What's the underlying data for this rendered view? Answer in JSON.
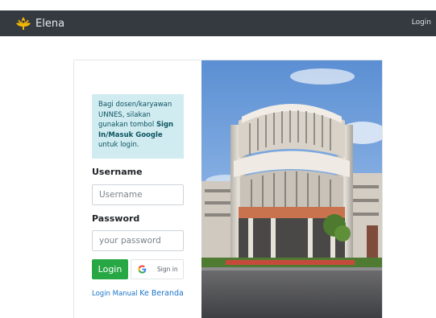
{
  "navbar": {
    "brand": "Elena",
    "login_link": "Login",
    "logo_icon": "unnes-logo-icon",
    "background": "#343a40"
  },
  "info": {
    "text_plain": "Bagi dosen/karyawan UNNES, silakan gunakan tombol ",
    "text_bold": "Sign In/Masuk Google",
    "text_after": " untuk login."
  },
  "form": {
    "username_label": "Username",
    "username_placeholder": "Username",
    "password_label": "Password",
    "password_placeholder": "your password",
    "login_button": "Login",
    "google_button": "Sign in",
    "google_icon": "google-g-icon",
    "login_manual_link": "Login Manual",
    "home_link": "Ke Beranda"
  },
  "colors": {
    "login_button": "#28a745",
    "info_bg": "#d1ecf1",
    "link": "#1a73c8"
  }
}
